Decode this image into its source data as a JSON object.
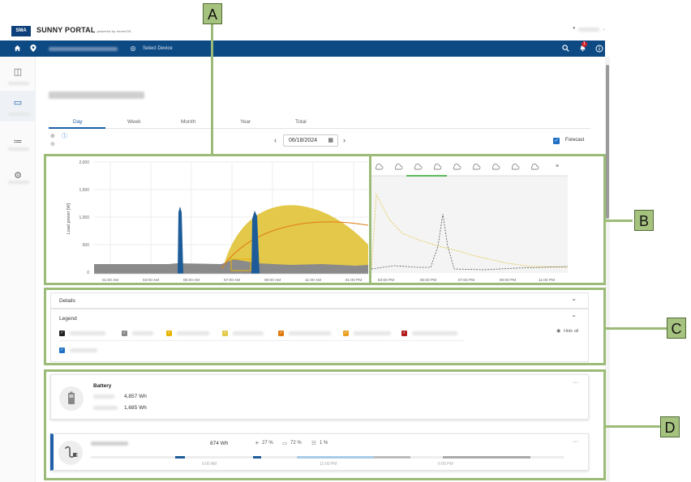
{
  "header": {
    "logo_text": "SMA",
    "brand": "SUNNY PORTAL",
    "brand_sub": "powered by ennexOS",
    "select_device": "Select Device",
    "notification_count": "1"
  },
  "tabs": [
    "Day",
    "Week",
    "Month",
    "Year",
    "Total"
  ],
  "date": {
    "value": "06/18/2024",
    "prev": "‹",
    "next": "›"
  },
  "forecast": {
    "label": "Forecast",
    "checked": true
  },
  "chart_main": {
    "ylabel": "Load power [W]",
    "yticks": [
      "2,000",
      "1,500",
      "1,000",
      "500",
      "0"
    ],
    "xticks": [
      "01:00 AM",
      "03:00 AM",
      "05:00 AM",
      "07:00 AM",
      "09:00 AM",
      "11:00 AM",
      "01:00 PM"
    ]
  },
  "chart_forecast": {
    "xticks": [
      "03:00 PM",
      "05:00 PM",
      "07:00 PM",
      "09:00 PM",
      "11:00 PM"
    ],
    "weather_icons": 9,
    "menu_icon": "≡"
  },
  "details": {
    "label": "Details",
    "chevron": "⌄"
  },
  "legend": {
    "label": "Legend",
    "chevron": "⌃",
    "hide_all": "Hide all",
    "colors": [
      "#222222",
      "#8a8a8a",
      "#e8b400",
      "#e3c94a",
      "#e07a10",
      "#e8a020",
      "#b01e1e",
      "#1f6fc4"
    ]
  },
  "battery": {
    "title": "Battery",
    "value1": "4,857 Wh",
    "value2": "1,685 Wh",
    "menu": "···"
  },
  "consumer": {
    "value": "874 Wh",
    "stat1": "27 %",
    "stat2": "72 %",
    "stat3": "1 %",
    "menu": "···",
    "times": [
      "6:00 AM",
      "12:00 PM",
      "6:00 PM"
    ]
  },
  "callouts": {
    "a": "A",
    "b": "B",
    "c": "C",
    "d": "D"
  }
}
